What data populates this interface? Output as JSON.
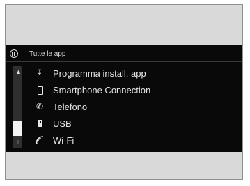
{
  "header": {
    "title": "Tutte le app",
    "icon": "apps-grid-icon"
  },
  "apps": [
    {
      "label": "Programma install. app",
      "icon": "install-app-icon"
    },
    {
      "label": "Smartphone Connection",
      "icon": "smartphone-icon"
    },
    {
      "label": "Telefono",
      "icon": "phone-icon"
    },
    {
      "label": "USB",
      "icon": "usb-icon"
    },
    {
      "label": "Wi-Fi",
      "icon": "wifi-icon"
    }
  ],
  "colors": {
    "screen_bg": "#090909",
    "text": "#e6e6e6",
    "scroll_track": "#2f2f2f",
    "scroll_thumb": "#f3f3f3"
  }
}
